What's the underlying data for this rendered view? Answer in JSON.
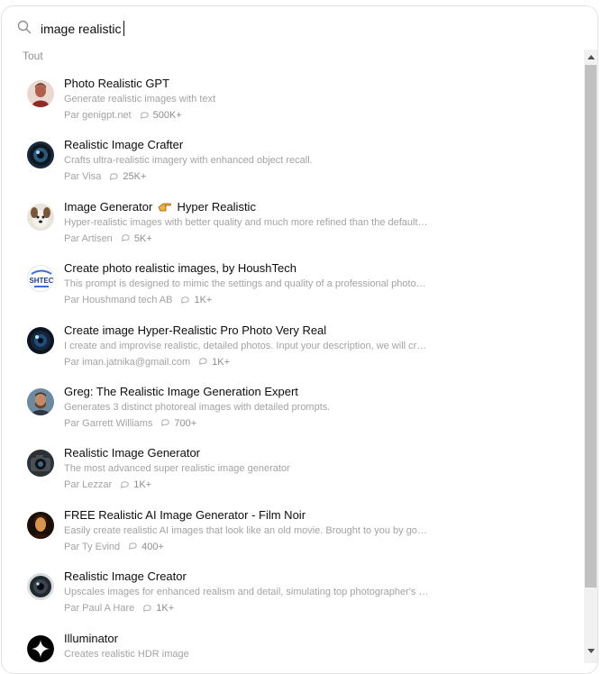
{
  "search": {
    "value": "image realistic"
  },
  "section_label": "Tout",
  "items": [
    {
      "title": "Photo Realistic GPT",
      "description": "Generate realistic images with text",
      "author": "Par genigpt.net",
      "count": "500K+",
      "avatar": "portrait-avatar"
    },
    {
      "title": "Realistic Image Crafter",
      "description": "Crafts ultra-realistic imagery with enhanced object recall.",
      "author": "Par Visa",
      "count": "25K+",
      "avatar": "camera-lens-avatar"
    },
    {
      "title": "Image Generator",
      "title_suffix": "Hyper Realistic",
      "description": "Hyper-realistic images with better quality and much more refined than the default i...",
      "author": "Par Artisen",
      "count": "5K+",
      "avatar": "dog-avatar"
    },
    {
      "title": "Create photo realistic images, by HoushTech",
      "description": "This prompt is designed to mimic the settings and quality of a professional photog...",
      "author": "Par Houshmand tech AB",
      "count": "1K+",
      "avatar": "houshtech-logo-avatar",
      "avatar_text": "SHTEC"
    },
    {
      "title": "Create image Hyper-Realistic Pro Photo Very Real",
      "description": "I create and improvise realistic, detailed photos. Input your description, we will crea...",
      "author": "Par iman.jatnika@gmail.com",
      "count": "1K+",
      "avatar": "lens-avatar"
    },
    {
      "title": "Greg: The Realistic Image Generation Expert",
      "description": "Generates 3 distinct photoreal images with detailed prompts.",
      "author": "Par Garrett Williams",
      "count": "700+",
      "avatar": "bearded-man-avatar"
    },
    {
      "title": "Realistic Image Generator",
      "description": "The most advanced super realistic image generator",
      "author": "Par Lezzar",
      "count": "1K+",
      "avatar": "camera-avatar"
    },
    {
      "title": "FREE Realistic AI Image Generator - Film Noir",
      "description": "Easily create realistic AI images that look like an old movie. Brought to you by goin...",
      "author": "Par Ty Evind",
      "count": "400+",
      "avatar": "film-noir-avatar"
    },
    {
      "title": "Realistic Image Creator",
      "description": "Upscales images for enhanced realism and detail, simulating top photographer's le...",
      "author": "Par Paul A Hare",
      "count": "1K+",
      "avatar": "lens-avatar-2"
    },
    {
      "title": "Illuminator",
      "description": "Creates realistic HDR image",
      "author": "",
      "count": "",
      "avatar": "star-avatar"
    }
  ],
  "colors": {
    "title": "#0d0d0d",
    "muted": "#a3a3a3",
    "border": "#e3e3e3"
  }
}
